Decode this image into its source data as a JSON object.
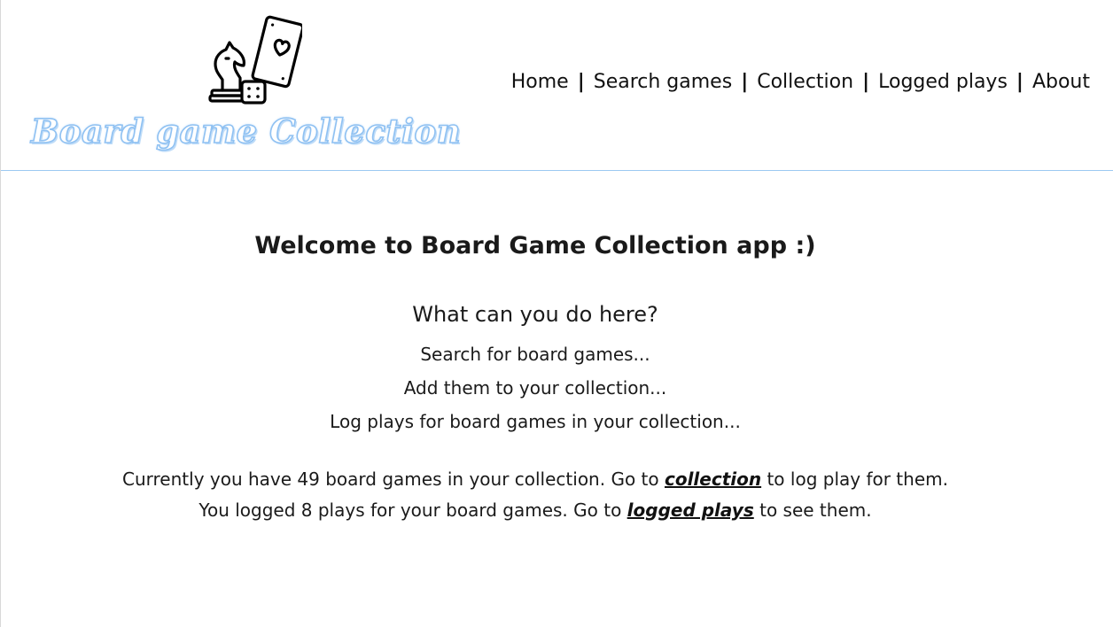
{
  "header": {
    "brand_title": "Board game Collection",
    "logo_icon": "board-game-logo-icon",
    "accent_color": "#8fc1f2"
  },
  "nav": {
    "items": [
      {
        "label": "Home"
      },
      {
        "label": "Search games"
      },
      {
        "label": "Collection"
      },
      {
        "label": "Logged plays"
      },
      {
        "label": "About"
      }
    ],
    "separator": "|"
  },
  "main": {
    "welcome": "Welcome to Board Game Collection app :)",
    "subtitle": "What can you do here?",
    "features": [
      "Search for board games...",
      "Add them to your collection...",
      "Log plays for board games in your collection..."
    ],
    "collection_stat": {
      "before": "Currently you have 49 board games in your collection. Go to",
      "link": "collection",
      "after": "to log play for them."
    },
    "plays_stat": {
      "before": "You logged 8 plays for your board games. Go to",
      "link": "logged plays",
      "after": "to see them."
    }
  }
}
